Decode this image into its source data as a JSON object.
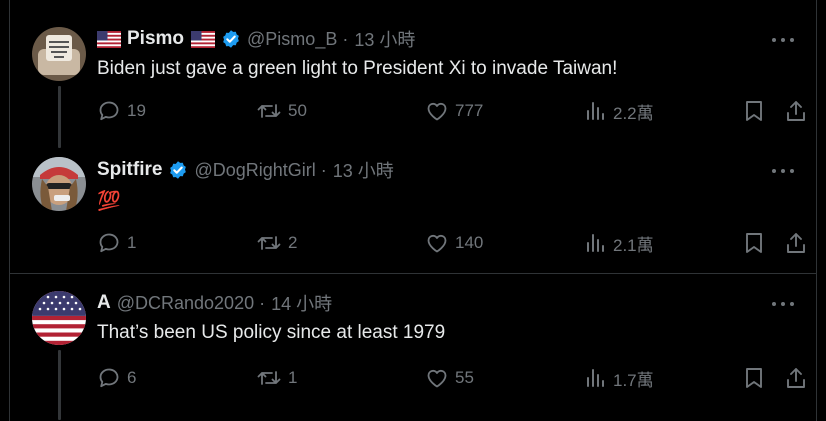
{
  "tweets": [
    {
      "name": "Pismo",
      "name_flags": true,
      "verified": true,
      "handle": "@Pismo_B",
      "separator": "·",
      "time": "13 小時",
      "text": "Biden just gave a green light to President Xi to invade Taiwan!",
      "replies": "19",
      "retweets": "50",
      "likes": "777",
      "views": "2.2萬"
    },
    {
      "name": "Spitfire",
      "verified": true,
      "handle": "@DogRightGirl",
      "separator": "·",
      "time": "13 小時",
      "text": "💯",
      "replies": "1",
      "retweets": "2",
      "likes": "140",
      "views": "2.1萬"
    },
    {
      "name": "A",
      "verified": false,
      "handle": "@DCRando2020",
      "separator": "·",
      "time": "14 小時",
      "text": "That’s been US policy since at least 1979",
      "replies": "6",
      "retweets": "1",
      "likes": "55",
      "views": "1.7萬"
    }
  ],
  "colors": {
    "background": "#000000",
    "text_primary": "#e7e9ea",
    "text_secondary": "#71767b",
    "verified_blue": "#1d9bf0",
    "divider": "#2f3336"
  },
  "icons": [
    "us-flag-icon",
    "verified-badge-icon",
    "more-icon",
    "reply-icon",
    "retweet-icon",
    "like-icon",
    "views-icon",
    "bookmark-icon",
    "share-icon"
  ]
}
